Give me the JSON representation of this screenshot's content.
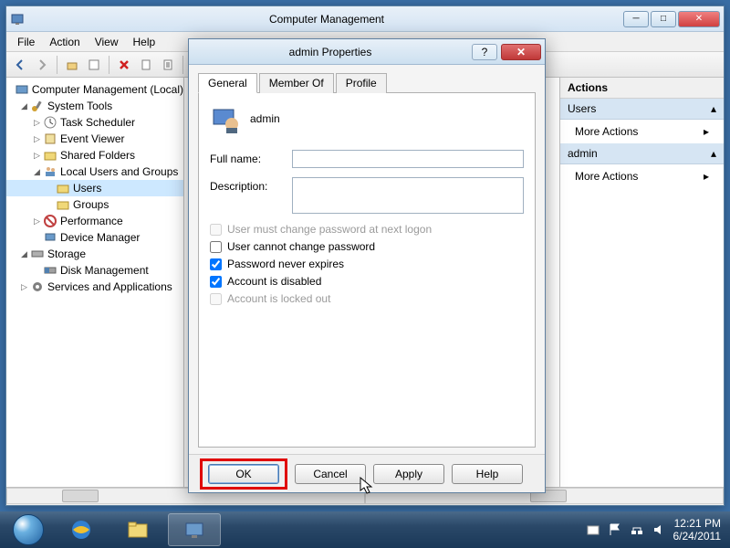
{
  "window": {
    "title": "Computer Management",
    "menu": [
      "File",
      "Action",
      "View",
      "Help"
    ]
  },
  "tree": {
    "root": "Computer Management (Local)",
    "system_tools": "System Tools",
    "task_scheduler": "Task Scheduler",
    "event_viewer": "Event Viewer",
    "shared_folders": "Shared Folders",
    "local_users_groups": "Local Users and Groups",
    "users": "Users",
    "groups": "Groups",
    "performance": "Performance",
    "device_manager": "Device Manager",
    "storage": "Storage",
    "disk_management": "Disk Management",
    "services_apps": "Services and Applications"
  },
  "actions": {
    "header": "Actions",
    "section1": "Users",
    "more1": "More Actions",
    "section2": "admin",
    "more2": "More Actions"
  },
  "dialog": {
    "title": "admin Properties",
    "tabs": [
      "General",
      "Member Of",
      "Profile"
    ],
    "username": "admin",
    "fullname_label": "Full name:",
    "fullname_value": "",
    "description_label": "Description:",
    "description_value": "",
    "chk_must_change": "User must change password at next logon",
    "chk_cannot_change": "User cannot change password",
    "chk_never_expires": "Password never expires",
    "chk_disabled": "Account is disabled",
    "chk_locked": "Account is locked out",
    "state": {
      "must_change": false,
      "cannot_change": false,
      "never_expires": true,
      "disabled": true,
      "locked": false
    },
    "buttons": {
      "ok": "OK",
      "cancel": "Cancel",
      "apply": "Apply",
      "help": "Help"
    }
  },
  "tray": {
    "time": "12:21 PM",
    "date": "6/24/2011"
  }
}
